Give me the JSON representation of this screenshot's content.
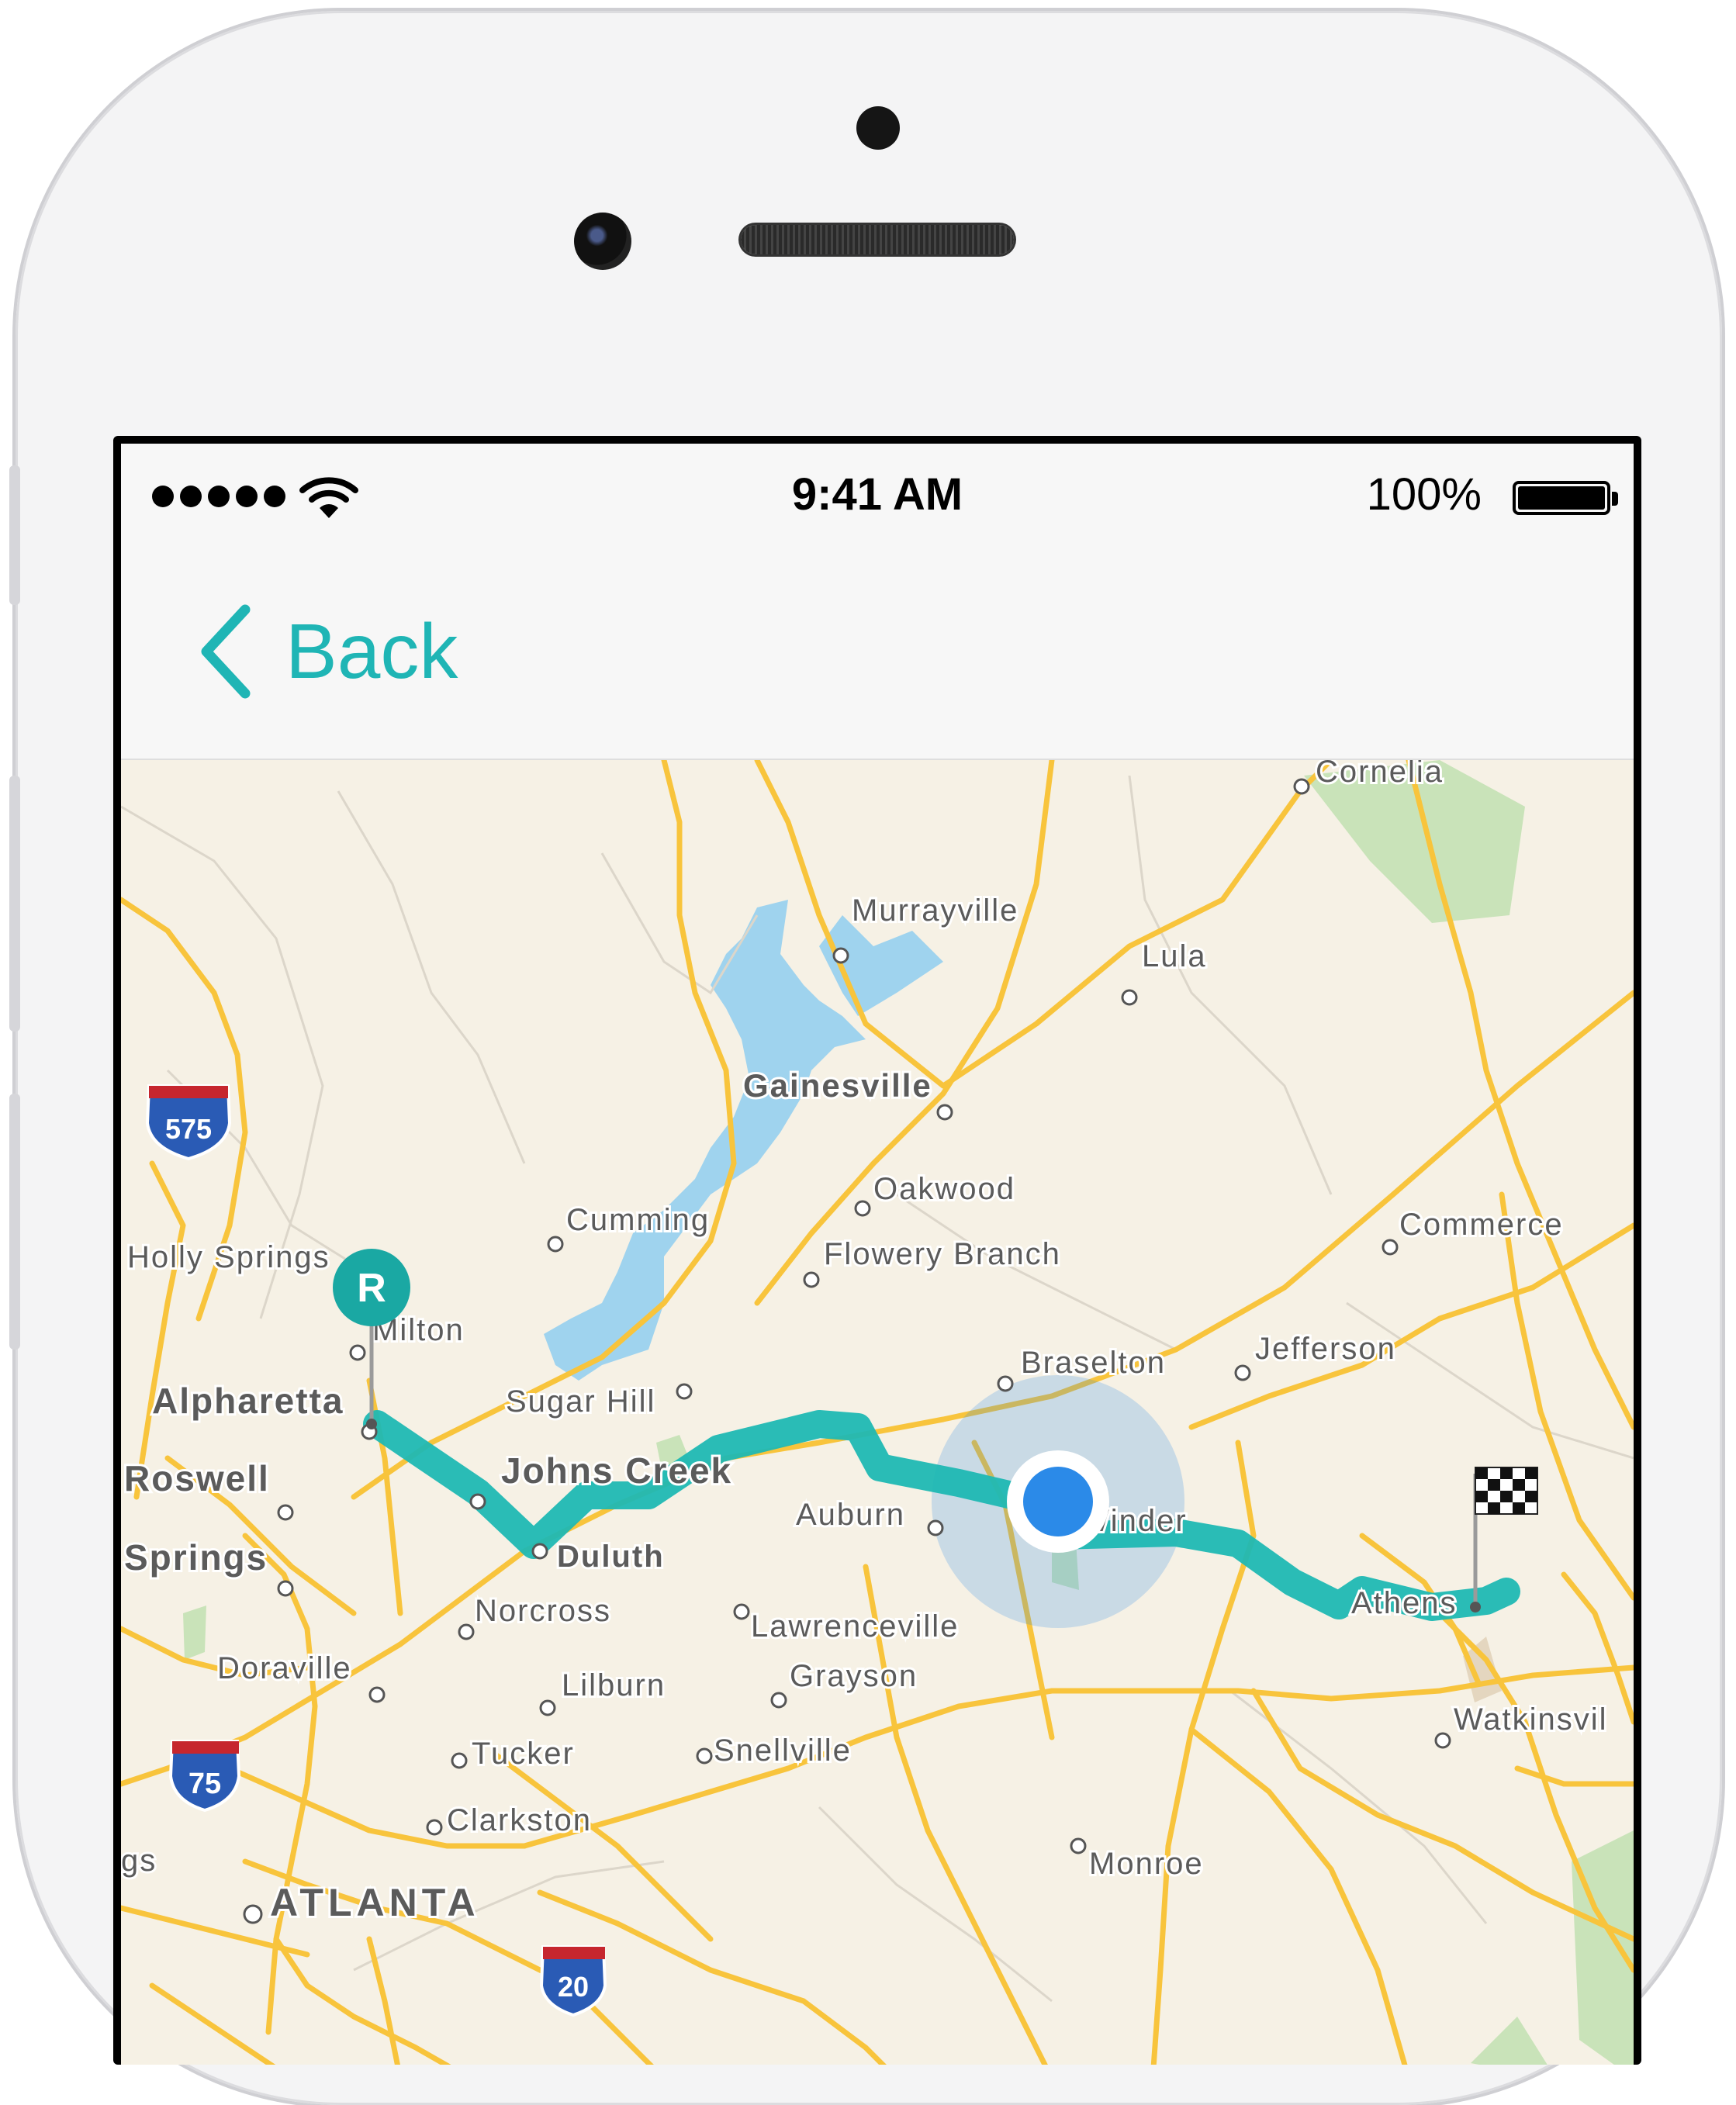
{
  "status_bar": {
    "time": "9:41 AM",
    "battery": "100%"
  },
  "nav": {
    "back_label": "Back"
  },
  "map": {
    "towns": {
      "cornelia": "Cornelia",
      "murrayville": "Murrayville",
      "lula": "Lula",
      "gainesville": "Gainesville",
      "oakwood": "Oakwood",
      "commerce": "Commerce",
      "cumming": "Cumming",
      "flowery_branch": "Flowery Branch",
      "holly_springs": "Holly Springs",
      "milton": "Milton",
      "braselton": "Braselton",
      "jefferson": "Jefferson",
      "alpharetta": "Alpharetta",
      "sugar_hill": "Sugar Hill",
      "roswell": "Roswell",
      "johns_creek": "Johns Creek",
      "auburn": "Auburn",
      "winder": "Winder",
      "springs": "Springs",
      "duluth": "Duluth",
      "norcross": "Norcross",
      "athens": "Athens",
      "lawrenceville": "Lawrenceville",
      "doraville": "Doraville",
      "lilburn": "Lilburn",
      "grayson": "Grayson",
      "watkinsville": "Watkinsvil",
      "tucker": "Tucker",
      "snellville": "Snellville",
      "clarkston": "Clarkston",
      "monroe": "Monroe",
      "gs": "gs",
      "atlanta": "ATLANTA"
    },
    "shields": {
      "i575": "575",
      "i75": "75",
      "i20": "20"
    },
    "start_pin": "R",
    "colors": {
      "route": "#1fb8b3",
      "road": "#f8c43c",
      "land": "#f6f1e5",
      "water": "#9fd3ee",
      "park": "#c9e3b9",
      "user": "#2b8ae8"
    }
  }
}
